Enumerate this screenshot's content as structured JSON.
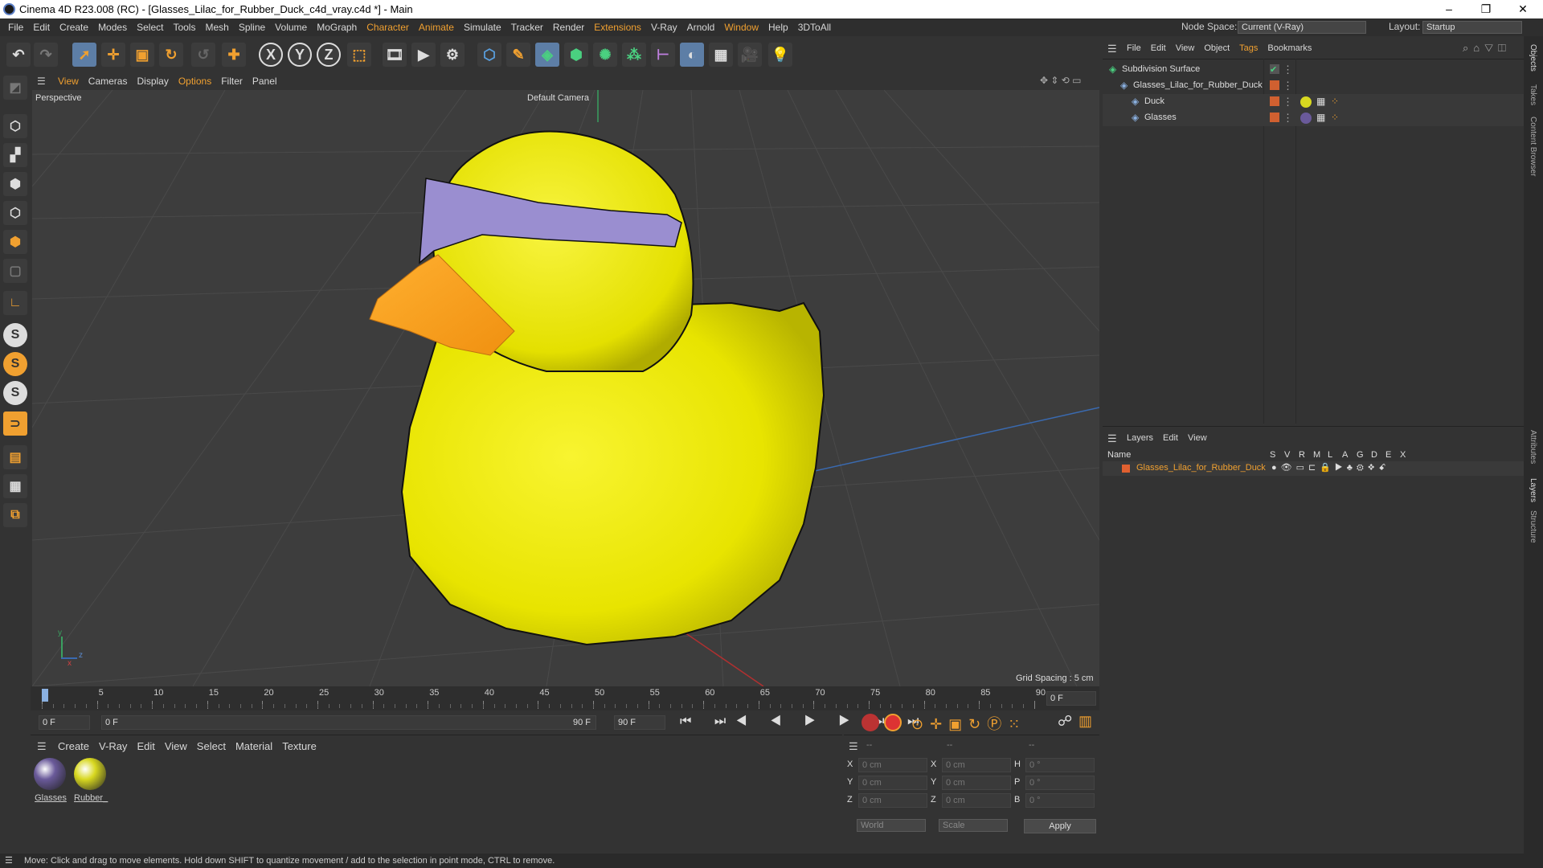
{
  "window": {
    "title": "Cinema 4D R23.008 (RC) - [Glasses_Lilac_for_Rubber_Duck_c4d_vray.c4d *] - Main",
    "min": "–",
    "max": "❐",
    "close": "✕"
  },
  "menubar": {
    "items": [
      "File",
      "Edit",
      "Create",
      "Modes",
      "Select",
      "Tools",
      "Mesh",
      "Spline",
      "Volume",
      "MoGraph",
      "Character",
      "Animate",
      "Simulate",
      "Tracker",
      "Render",
      "Extensions",
      "V-Ray",
      "Arnold",
      "Window",
      "Help",
      "3DToAll"
    ],
    "node_space_label": "Node Space:",
    "node_space_value": "Current (V-Ray)",
    "layout_label": "Layout:",
    "layout_value": "Startup"
  },
  "toolbar": {
    "axis_x": "X",
    "axis_y": "Y",
    "axis_z": "Z"
  },
  "viewport": {
    "menu": [
      "View",
      "Cameras",
      "Display",
      "Options",
      "Filter",
      "Panel"
    ],
    "view_name": "Perspective",
    "camera": "Default Camera",
    "grid_spacing": "Grid Spacing : 5 cm",
    "axis_y": "y",
    "axis_z": "z",
    "axis_x": "x"
  },
  "timeline": {
    "ticks": [
      "0",
      "5",
      "10",
      "15",
      "20",
      "25",
      "30",
      "35",
      "40",
      "45",
      "50",
      "55",
      "60",
      "65",
      "70",
      "75",
      "80",
      "85",
      "90"
    ],
    "current_frame": "0 F"
  },
  "transport": {
    "start": "0 F",
    "range_start": "0 F",
    "range_end": "90 F",
    "end": "90 F"
  },
  "materials": {
    "menu": [
      "Create",
      "V-Ray",
      "Edit",
      "View",
      "Select",
      "Material",
      "Texture"
    ],
    "items": [
      {
        "name": "Glasses",
        "color": "#6a5a9a"
      },
      {
        "name": "Rubber_",
        "color": "#d8d820"
      }
    ]
  },
  "coords": {
    "header_a": "--",
    "header_b": "--",
    "header_c": "--",
    "rows": [
      {
        "l1": "X",
        "v1": "0 cm",
        "l2": "X",
        "v2": "0 cm",
        "l3": "H",
        "v3": "0 °"
      },
      {
        "l1": "Y",
        "v1": "0 cm",
        "l2": "Y",
        "v2": "0 cm",
        "l3": "P",
        "v3": "0 °"
      },
      {
        "l1": "Z",
        "v1": "0 cm",
        "l2": "Z",
        "v2": "0 cm",
        "l3": "B",
        "v3": "0 °"
      }
    ],
    "world": "World",
    "scale": "Scale",
    "apply": "Apply"
  },
  "objects": {
    "menu": [
      "File",
      "Edit",
      "View",
      "Object",
      "Tags",
      "Bookmarks"
    ],
    "items": [
      {
        "name": "Subdivision Surface",
        "indent": 0
      },
      {
        "name": "Glasses_Lilac_for_Rubber_Duck",
        "indent": 1
      },
      {
        "name": "Duck",
        "indent": 2
      },
      {
        "name": "Glasses",
        "indent": 2
      }
    ]
  },
  "layers": {
    "menu": [
      "Layers",
      "Edit",
      "View"
    ],
    "col_name": "Name",
    "cols": [
      "S",
      "V",
      "R",
      "M",
      "L",
      "A",
      "G",
      "D",
      "E",
      "X"
    ],
    "layer_name": "Glasses_Lilac_for_Rubber_Duck"
  },
  "rightstrip": {
    "tabs": [
      "Objects",
      "Takes",
      "Content Browser",
      "Attributes",
      "Layers",
      "Structure"
    ]
  },
  "status": "Move: Click and drag to move elements. Hold down SHIFT to quantize movement / add to the selection in point mode, CTRL to remove."
}
